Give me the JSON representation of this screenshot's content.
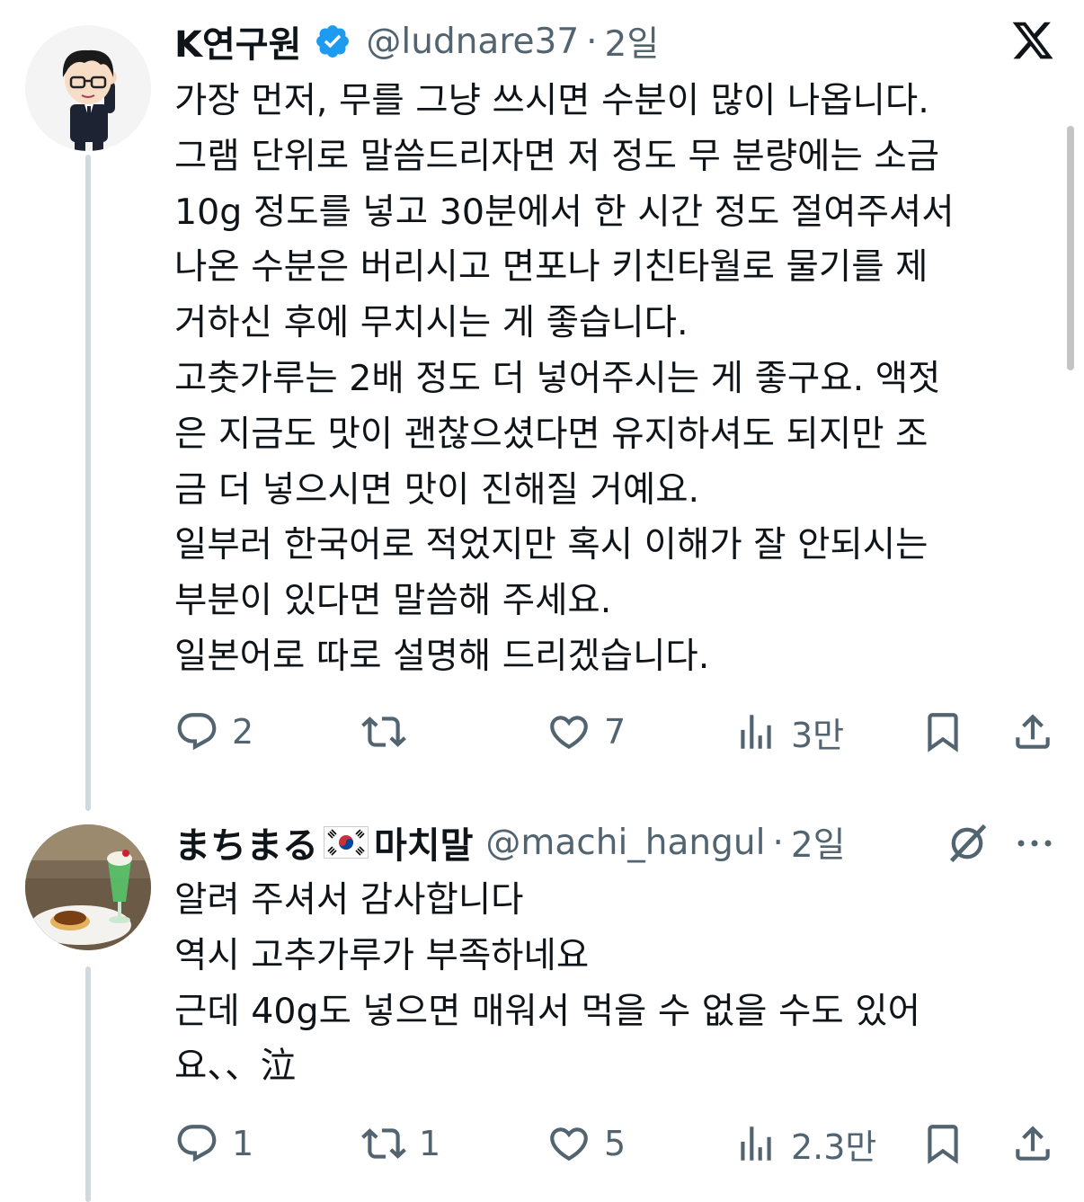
{
  "tweets": [
    {
      "display_name": "K연구원",
      "handle": "@ludnare37",
      "separator": "·",
      "time": "2일",
      "lines": [
        "가장 먼저, 무를 그냥 쓰시면 수분이 많이 나옵니다.",
        "그램 단위로 말씀드리자면 저 정도 무 분량에는 소금",
        "10g 정도를 넣고 30분에서 한 시간 정도 절여주셔서",
        "나온 수분은 버리시고 면포나 키친타월로 물기를 제",
        "거하신 후에 무치시는 게 좋습니다.",
        "고춧가루는 2배 정도 더 넣어주시는 게 좋구요. 액젓",
        "은 지금도 맛이 괜찮으셨다면 유지하셔도 되지만 조",
        "금 더 넣으시면 맛이 진해질 거예요.",
        "일부러 한국어로 적었지만 혹시 이해가 잘 안되시는",
        "부분이 있다면 말씀해 주세요.",
        "일본어로 따로 설명해 드리겠습니다."
      ],
      "stats": {
        "replies": "2",
        "retweets": "",
        "likes": "7",
        "views": "3만"
      },
      "icons": [
        "reply-icon",
        "retweet-icon",
        "like-icon",
        "views-icon",
        "bookmark-icon",
        "share-icon",
        "x-logo-icon",
        "verified-badge-icon"
      ]
    },
    {
      "display_name_jp": "まちまる",
      "display_name_kr": "마치말",
      "handle": "@machi_hangul",
      "separator": "·",
      "time": "2일",
      "lines": [
        "알려 주셔서 감사합니다",
        "역시 고추가루가 부족하네요",
        "근데 40g도 넣으면 매워서 먹을 수 없을 수도 있어",
        "요、、泣"
      ],
      "stats": {
        "replies": "1",
        "retweets": "1",
        "likes": "5",
        "views": "2.3만"
      },
      "icons": [
        "reply-icon",
        "retweet-icon",
        "like-icon",
        "views-icon",
        "bookmark-icon",
        "share-icon",
        "korea-flag-icon",
        "grok-icon",
        "more-icon"
      ]
    }
  ],
  "colors": {
    "text": "#0f1419",
    "secondary": "#536471",
    "verified": "#1d9bf0",
    "thread_line": "#cfd9de"
  }
}
